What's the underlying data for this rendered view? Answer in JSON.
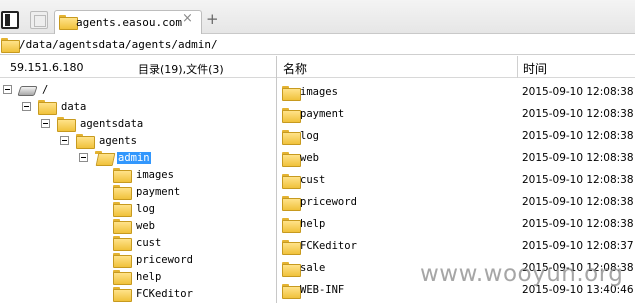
{
  "tab": {
    "title": "agents.easou.com",
    "close": "×",
    "new_tab": "+"
  },
  "path": "/data/agentsdata/agents/admin/",
  "info": {
    "ip": "59.151.6.180",
    "summary": "目录(19),文件(3)"
  },
  "columns": {
    "name": "名称",
    "time": "时间"
  },
  "tree": [
    {
      "label": "/",
      "icon": "drive-icon",
      "depth": 0,
      "toggle": true
    },
    {
      "label": "data",
      "icon": "folder-icon",
      "depth": 1,
      "toggle": true
    },
    {
      "label": "agentsdata",
      "icon": "folder-icon",
      "depth": 2,
      "toggle": true
    },
    {
      "label": "agents",
      "icon": "folder-icon",
      "depth": 3,
      "toggle": true
    },
    {
      "label": "admin",
      "icon": "folder-open-icon",
      "depth": 4,
      "toggle": true,
      "selected": true
    },
    {
      "label": "images",
      "icon": "folder-icon",
      "depth": 5,
      "toggle": false
    },
    {
      "label": "payment",
      "icon": "folder-icon",
      "depth": 5,
      "toggle": false
    },
    {
      "label": "log",
      "icon": "folder-icon",
      "depth": 5,
      "toggle": false
    },
    {
      "label": "web",
      "icon": "folder-icon",
      "depth": 5,
      "toggle": false
    },
    {
      "label": "cust",
      "icon": "folder-icon",
      "depth": 5,
      "toggle": false
    },
    {
      "label": "priceword",
      "icon": "folder-icon",
      "depth": 5,
      "toggle": false
    },
    {
      "label": "help",
      "icon": "folder-icon",
      "depth": 5,
      "toggle": false
    },
    {
      "label": "FCKeditor",
      "icon": "folder-icon",
      "depth": 5,
      "toggle": false
    }
  ],
  "files": [
    {
      "name": "images",
      "time": "2015-09-10 12:08:38"
    },
    {
      "name": "payment",
      "time": "2015-09-10 12:08:38"
    },
    {
      "name": "log",
      "time": "2015-09-10 12:08:38"
    },
    {
      "name": "web",
      "time": "2015-09-10 12:08:38"
    },
    {
      "name": "cust",
      "time": "2015-09-10 12:08:38"
    },
    {
      "name": "priceword",
      "time": "2015-09-10 12:08:38"
    },
    {
      "name": "help",
      "time": "2015-09-10 12:08:38"
    },
    {
      "name": "FCKeditor",
      "time": "2015-09-10 12:08:37"
    },
    {
      "name": "sale",
      "time": "2015-09-10 12:08:38"
    },
    {
      "name": "WEB-INF",
      "time": "2015-09-10 13:40:46"
    }
  ],
  "watermark": "www.wooyun.org",
  "colors": {
    "selection": "#3297fd",
    "folder": "#f0c13b",
    "watermark": "#969696"
  }
}
